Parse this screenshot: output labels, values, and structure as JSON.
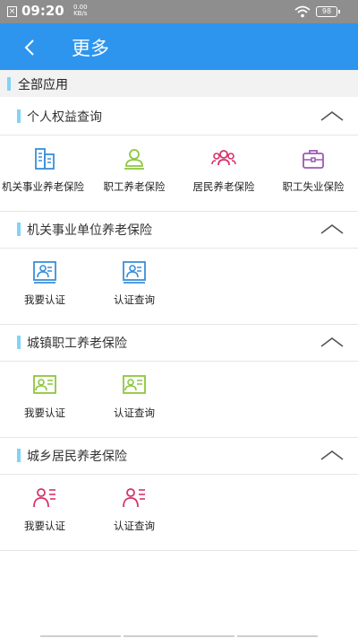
{
  "status_bar": {
    "time": "09:20",
    "speed_value": "0.00",
    "speed_unit": "KB/s",
    "battery": "98"
  },
  "nav": {
    "title": "更多",
    "back_icon": "chevron-left-icon"
  },
  "all_apps_label": "全部应用",
  "colors": {
    "primary": "#2d95ee",
    "accent_bar": "#7fd4f7",
    "blue_icon": "#3a8fd9",
    "green_icon": "#8cc63f",
    "red_icon": "#d6336c",
    "purple_icon": "#9b59b6"
  },
  "sections": [
    {
      "title": "个人权益查询",
      "items": [
        {
          "label": "机关事业养老保险",
          "icon": "building-icon"
        },
        {
          "label": "职工养老保险",
          "icon": "person-icon"
        },
        {
          "label": "居民养老保险",
          "icon": "people-group-icon"
        },
        {
          "label": "职工失业保险",
          "icon": "briefcase-icon"
        }
      ]
    },
    {
      "title": "机关事业单位养老保险",
      "items": [
        {
          "label": "我要认证",
          "icon": "id-card-icon"
        },
        {
          "label": "认证查询",
          "icon": "id-card-icon"
        }
      ]
    },
    {
      "title": "城镇职工养老保险",
      "items": [
        {
          "label": "我要认证",
          "icon": "id-card-icon"
        },
        {
          "label": "认证查询",
          "icon": "id-card-icon"
        }
      ]
    },
    {
      "title": "城乡居民养老保险",
      "items": [
        {
          "label": "我要认证",
          "icon": "person-list-icon"
        },
        {
          "label": "认证查询",
          "icon": "person-list-icon"
        }
      ]
    }
  ]
}
